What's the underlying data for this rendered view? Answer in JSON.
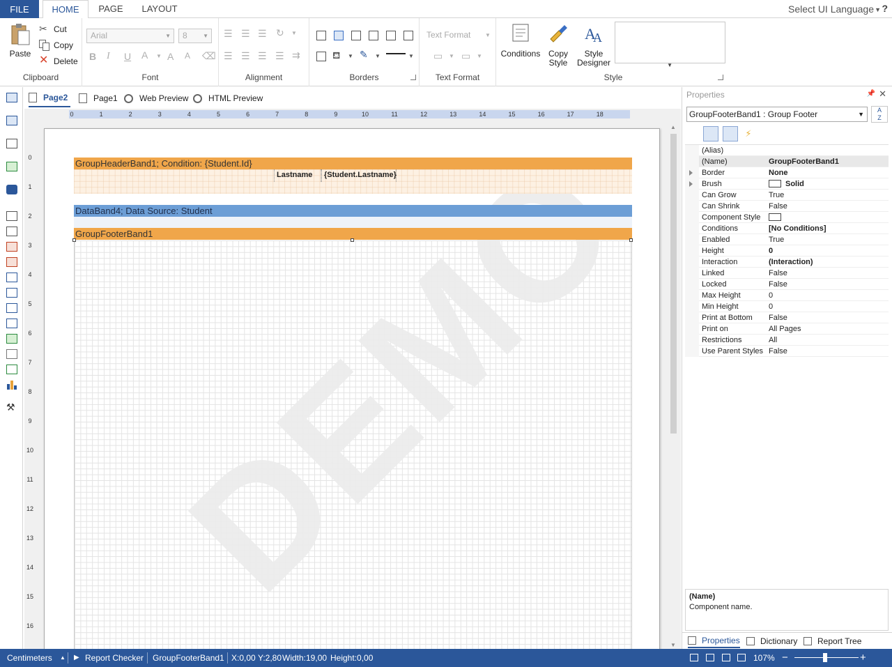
{
  "ribbon_tabs": {
    "file": "FILE",
    "home": "HOME",
    "page": "PAGE",
    "layout": "LAYOUT",
    "ui_language": "Select UI Language",
    "help": "?"
  },
  "clipboard": {
    "label": "Clipboard",
    "paste": "Paste",
    "cut": "Cut",
    "copy": "Copy",
    "delete": "Delete"
  },
  "font": {
    "label": "Font",
    "family": "Arial",
    "size": "8"
  },
  "alignment": {
    "label": "Alignment"
  },
  "borders": {
    "label": "Borders"
  },
  "text_format": {
    "label": "Text Format",
    "combo": "Text Format"
  },
  "style": {
    "label": "Style",
    "conditions": "Conditions",
    "copy_style_1": "Copy",
    "copy_style_2": "Style",
    "style_designer_1": "Style",
    "style_designer_2": "Designer"
  },
  "doc_tabs": {
    "page2": "Page2",
    "page1": "Page1",
    "web_preview": "Web Preview",
    "html_preview": "HTML Preview"
  },
  "ruler": {
    "h": [
      "0",
      "1",
      "2",
      "3",
      "4",
      "5",
      "6",
      "7",
      "8",
      "9",
      "10",
      "11",
      "12",
      "13",
      "14",
      "15",
      "16",
      "17",
      "18"
    ],
    "v": [
      "0",
      "1",
      "2",
      "3",
      "4",
      "5",
      "6",
      "7",
      "8",
      "9",
      "10",
      "11",
      "12",
      "13",
      "14",
      "15",
      "16"
    ]
  },
  "report": {
    "group_header": "GroupHeaderBand1; Condition: {Student.Id}",
    "lastname_label": "Lastname",
    "lastname_field": "{Student.Lastname}",
    "data_band": "DataBand4; Data Source: Student",
    "group_footer": "GroupFooterBand1",
    "watermark": "DEMO"
  },
  "properties": {
    "title": "Properties",
    "object": "GroupFooterBand1 : Group Footer",
    "sort_icon_top": "A",
    "sort_icon_bottom": "Z",
    "rows": [
      {
        "name": "(Alias)",
        "value": "",
        "bold": false,
        "expandable": false
      },
      {
        "name": "(Name)",
        "value": "GroupFooterBand1",
        "bold": true,
        "expandable": false,
        "selected": true
      },
      {
        "name": "Border",
        "value": "None",
        "bold": true,
        "expandable": true
      },
      {
        "name": "Brush",
        "value": "Solid",
        "bold": true,
        "expandable": true,
        "swatch": true
      },
      {
        "name": "Can Grow",
        "value": "True",
        "bold": false,
        "expandable": false
      },
      {
        "name": "Can Shrink",
        "value": "False",
        "bold": false,
        "expandable": false
      },
      {
        "name": "Component Style",
        "value": "",
        "bold": false,
        "expandable": false,
        "swatch": true
      },
      {
        "name": "Conditions",
        "value": "[No Conditions]",
        "bold": true,
        "expandable": false
      },
      {
        "name": "Enabled",
        "value": "True",
        "bold": false,
        "expandable": false
      },
      {
        "name": "Height",
        "value": "0",
        "bold": true,
        "expandable": false
      },
      {
        "name": "Interaction",
        "value": "(Interaction)",
        "bold": true,
        "expandable": false
      },
      {
        "name": "Linked",
        "value": "False",
        "bold": false,
        "expandable": false
      },
      {
        "name": "Locked",
        "value": "False",
        "bold": false,
        "expandable": false
      },
      {
        "name": "Max Height",
        "value": "0",
        "bold": false,
        "expandable": false
      },
      {
        "name": "Min Height",
        "value": "0",
        "bold": false,
        "expandable": false
      },
      {
        "name": "Print at Bottom",
        "value": "False",
        "bold": false,
        "expandable": false
      },
      {
        "name": "Print on",
        "value": "All Pages",
        "bold": false,
        "expandable": false
      },
      {
        "name": "Restrictions",
        "value": "All",
        "bold": false,
        "expandable": false
      },
      {
        "name": "Use Parent Styles",
        "value": "False",
        "bold": false,
        "expandable": false
      }
    ],
    "desc_title": "(Name)",
    "desc_text": "Component name.",
    "tabs": {
      "properties": "Properties",
      "dictionary": "Dictionary",
      "report_tree": "Report Tree"
    }
  },
  "status": {
    "units": "Centimeters",
    "checker": "Report Checker",
    "component": "GroupFooterBand1",
    "x": "X:0,00",
    "y": "Y:2,80",
    "width": "Width:19,00",
    "height": "Height:0,00",
    "zoom": "107%"
  },
  "colors": {
    "accent": "#2b579a",
    "band_orange": "#f0a64a",
    "band_blue": "#6c9ed6"
  }
}
